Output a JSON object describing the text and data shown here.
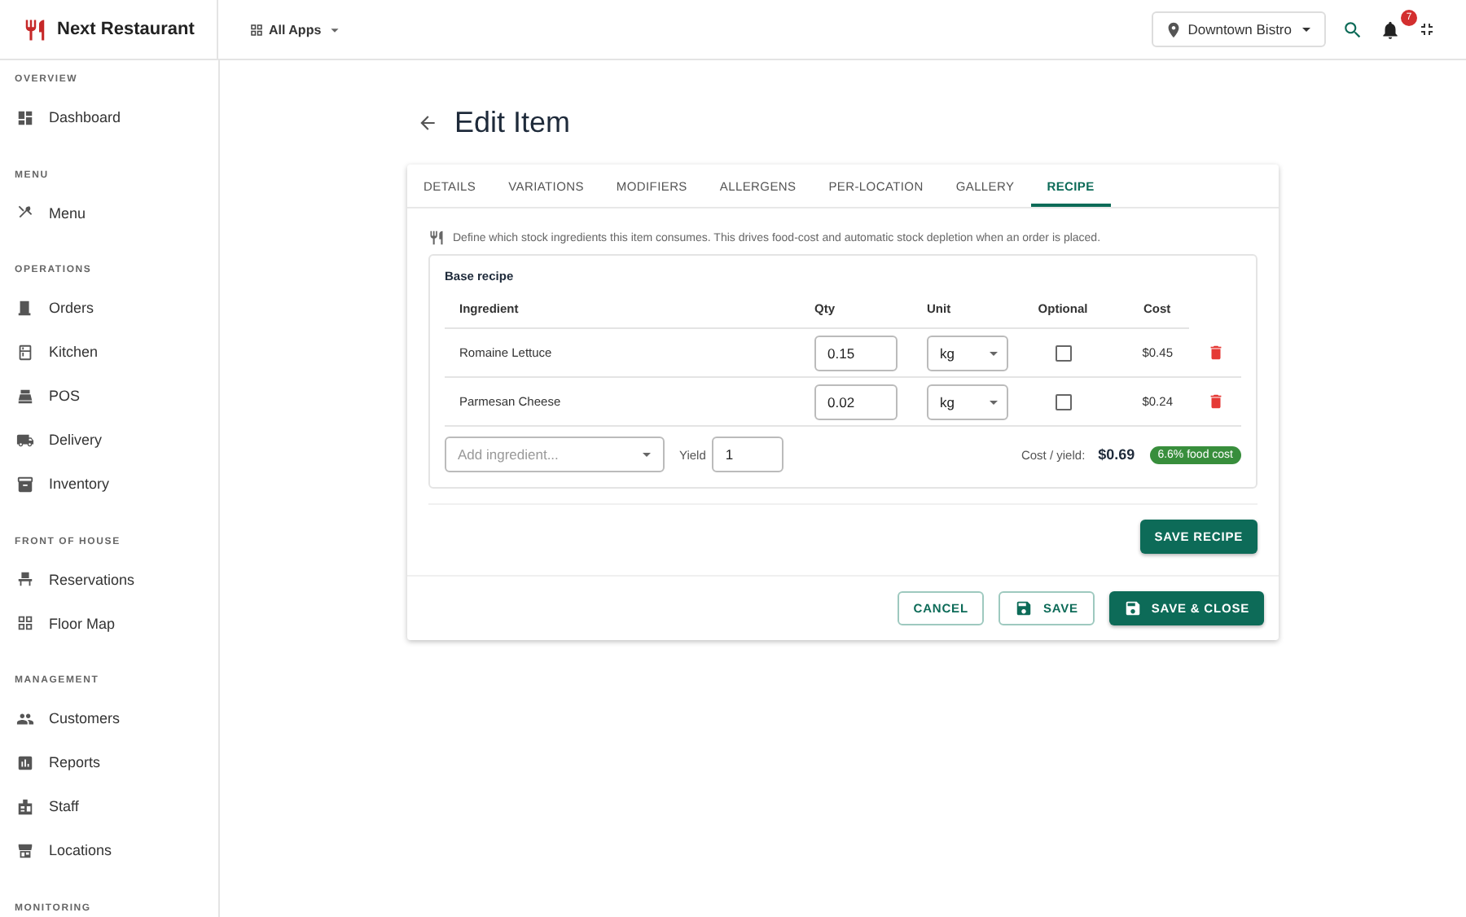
{
  "app": {
    "name": "Next Restaurant"
  },
  "topbar": {
    "apps_label": "All Apps",
    "location": "Downtown Bistro",
    "notification_count": "7"
  },
  "sidebar": {
    "sections": [
      {
        "heading": "OVERVIEW",
        "items": [
          {
            "label": "Dashboard"
          }
        ]
      },
      {
        "heading": "MENU",
        "items": [
          {
            "label": "Menu"
          }
        ]
      },
      {
        "heading": "OPERATIONS",
        "items": [
          {
            "label": "Orders"
          },
          {
            "label": "Kitchen"
          },
          {
            "label": "POS"
          },
          {
            "label": "Delivery"
          },
          {
            "label": "Inventory"
          }
        ]
      },
      {
        "heading": "FRONT OF HOUSE",
        "items": [
          {
            "label": "Reservations"
          },
          {
            "label": "Floor Map"
          }
        ]
      },
      {
        "heading": "MANAGEMENT",
        "items": [
          {
            "label": "Customers"
          },
          {
            "label": "Reports"
          },
          {
            "label": "Staff"
          },
          {
            "label": "Locations"
          }
        ]
      },
      {
        "heading": "MONITORING"
      }
    ]
  },
  "page": {
    "title": "Edit Item"
  },
  "tabs": [
    {
      "label": "DETAILS",
      "selected": false
    },
    {
      "label": "VARIATIONS",
      "selected": false
    },
    {
      "label": "MODIFIERS",
      "selected": false
    },
    {
      "label": "ALLERGENS",
      "selected": false
    },
    {
      "label": "PER-LOCATION",
      "selected": false
    },
    {
      "label": "GALLERY",
      "selected": false
    },
    {
      "label": "RECIPE",
      "selected": true
    }
  ],
  "recipe": {
    "info": "Define which stock ingredients this item consumes. This drives food-cost and automatic stock depletion when an order is placed.",
    "section_title": "Base recipe",
    "columns": [
      "Ingredient",
      "Qty",
      "Unit",
      "Optional",
      "Cost"
    ],
    "rows": [
      {
        "ingredient": "Romaine Lettuce",
        "qty": "0.15",
        "unit": "kg",
        "optional": false,
        "cost": "$0.45"
      },
      {
        "ingredient": "Parmesan Cheese",
        "qty": "0.02",
        "unit": "kg",
        "optional": false,
        "cost": "$0.24"
      }
    ],
    "add_placeholder": "Add ingredient...",
    "yield_label": "Yield",
    "yield_value": "1",
    "cost_label": "Cost / yield:",
    "cost_value": "$0.69",
    "badge": "6.6% food cost",
    "save_button": "SAVE RECIPE"
  },
  "actions": {
    "cancel": "CANCEL",
    "save": "SAVE",
    "save_close": "SAVE & CLOSE"
  }
}
